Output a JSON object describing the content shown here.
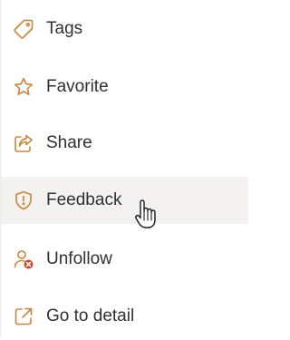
{
  "menu": {
    "items": [
      {
        "label": "Tags",
        "icon": "tag-icon"
      },
      {
        "label": "Favorite",
        "icon": "star-icon"
      },
      {
        "label": "Share",
        "icon": "share-icon"
      },
      {
        "label": "Feedback",
        "icon": "shield-alert-icon"
      },
      {
        "label": "Unfollow",
        "icon": "unfollow-icon"
      },
      {
        "label": "Go to detail",
        "icon": "open-external-icon"
      }
    ],
    "hovered_item": "Feedback"
  },
  "colors": {
    "icon_accent": "#c8853b",
    "unfollow_badge": "#d4462c",
    "text": "#323130",
    "hover_bg": "#f3f2f1"
  }
}
